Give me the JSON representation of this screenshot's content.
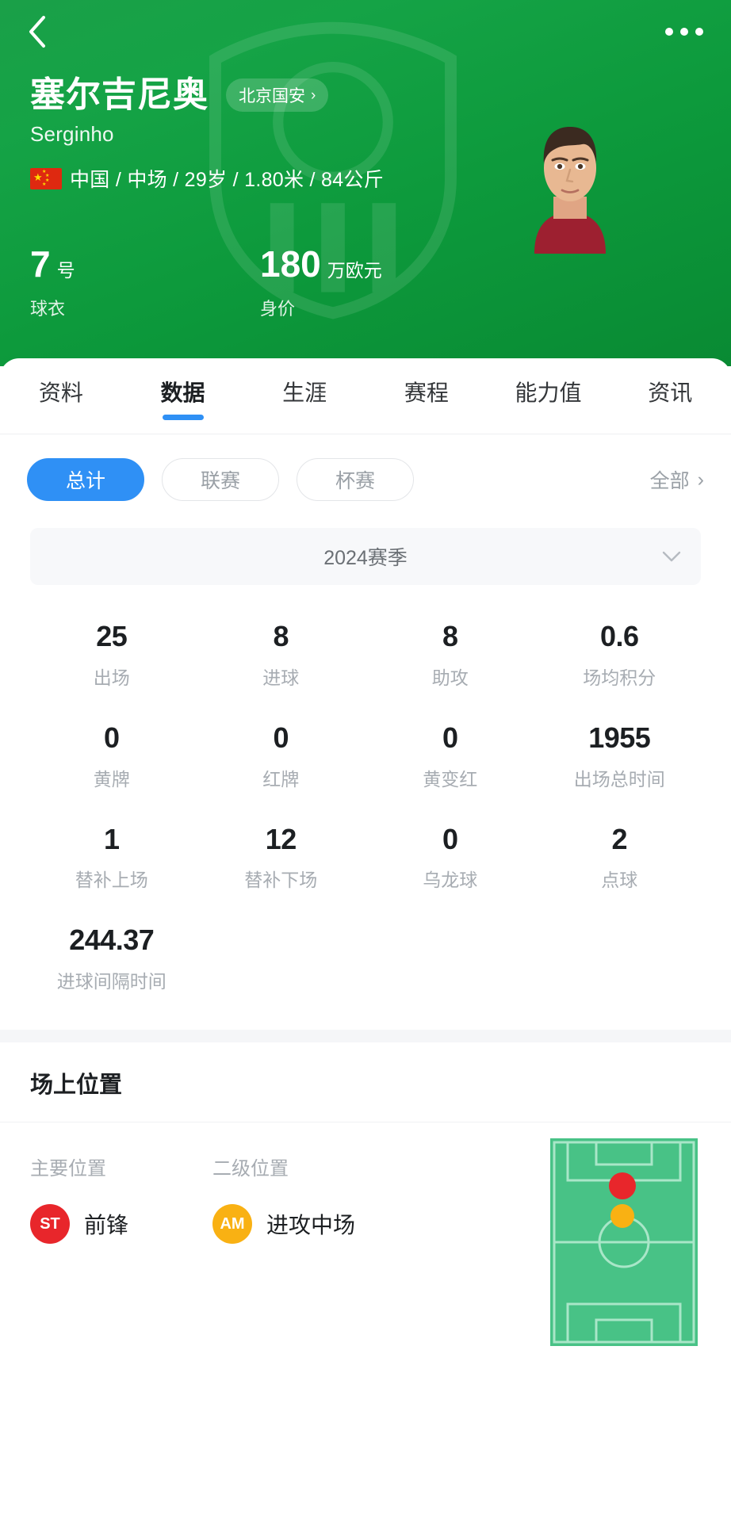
{
  "colors": {
    "header_green": "#0d9a3c",
    "accent_blue": "#2f90f5",
    "primary_pos": "#e8262b",
    "secondary_pos": "#f9b113",
    "pitch_green": "#48c286"
  },
  "navbar": {
    "back_icon": "chevron-left-icon",
    "more_icon": "more-horizontal-icon"
  },
  "player": {
    "name_cn": "塞尔吉尼奥",
    "name_en": "Serginho",
    "team": "北京国安",
    "team_chevron": "›",
    "nationality_flag": "china-flag-icon",
    "meta": "中国 / 中场 / 29岁 / 1.80米 / 84公斤",
    "kpis": [
      {
        "value": "7",
        "unit": "号",
        "label": "球衣"
      },
      {
        "value": "180",
        "unit": "万欧元",
        "label": "身价"
      }
    ]
  },
  "tabs": [
    {
      "label": "资料",
      "active": false
    },
    {
      "label": "数据",
      "active": true
    },
    {
      "label": "生涯",
      "active": false
    },
    {
      "label": "赛程",
      "active": false
    },
    {
      "label": "能力值",
      "active": false
    },
    {
      "label": "资讯",
      "active": false
    }
  ],
  "filters": {
    "chips": [
      {
        "label": "总计",
        "active": true
      },
      {
        "label": "联赛",
        "active": false
      },
      {
        "label": "杯赛",
        "active": false
      }
    ],
    "all_label": "全部",
    "all_chevron": "›"
  },
  "season": {
    "label": "2024赛季",
    "chevron_icon": "chevron-down-icon"
  },
  "stats": [
    {
      "value": "25",
      "label": "出场"
    },
    {
      "value": "8",
      "label": "进球"
    },
    {
      "value": "8",
      "label": "助攻"
    },
    {
      "value": "0.6",
      "label": "场均积分"
    },
    {
      "value": "0",
      "label": "黄牌"
    },
    {
      "value": "0",
      "label": "红牌"
    },
    {
      "value": "0",
      "label": "黄变红"
    },
    {
      "value": "1955",
      "label": "出场总时间"
    },
    {
      "value": "1",
      "label": "替补上场"
    },
    {
      "value": "12",
      "label": "替补下场"
    },
    {
      "value": "0",
      "label": "乌龙球"
    },
    {
      "value": "2",
      "label": "点球"
    },
    {
      "value": "244.37",
      "label": "进球间隔时间"
    }
  ],
  "position_section": {
    "title": "场上位置",
    "primary": {
      "heading": "主要位置",
      "code": "ST",
      "name": "前锋",
      "color": "#e8262b"
    },
    "secondary": {
      "heading": "二级位置",
      "code": "AM",
      "name": "进攻中场",
      "color": "#f9b113"
    },
    "pitch": {
      "icon": "football-pitch-diagram",
      "markers": [
        {
          "role": "primary",
          "color": "#e8262b",
          "x": 50,
          "y": 23
        },
        {
          "role": "secondary",
          "color": "#f9b113",
          "x": 50,
          "y": 37
        }
      ]
    }
  }
}
